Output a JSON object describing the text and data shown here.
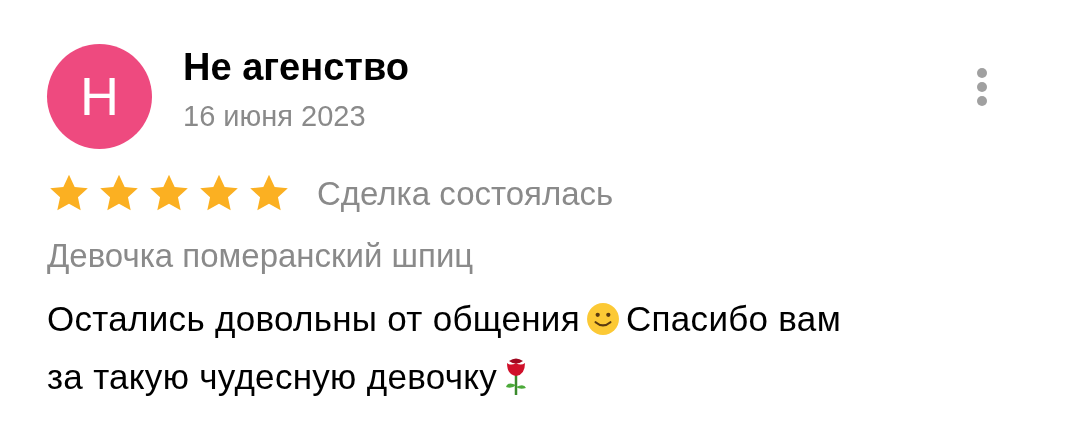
{
  "review": {
    "avatar_letter": "Н",
    "author": "Не агенство",
    "date": "16 июня 2023",
    "stars": 5,
    "status": "Сделка состоялась",
    "subject": "Девочка померанский шпиц",
    "body_lines": [
      [
        {
          "kind": "text",
          "text": "Остались довольны от общения"
        },
        {
          "kind": "smile"
        },
        {
          "kind": "text",
          "text": "Спасибо вам"
        }
      ],
      [
        {
          "kind": "text",
          "text": "за такую чудесную девочку"
        },
        {
          "kind": "rose"
        }
      ]
    ]
  }
}
